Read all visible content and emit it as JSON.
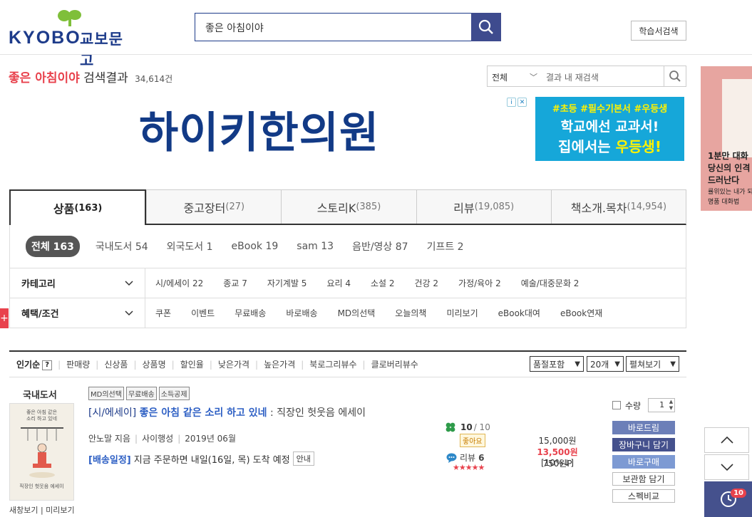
{
  "header": {
    "logo_en": "KYOBO",
    "logo_ko": "교보문고",
    "search_value": "좋은 아침이야",
    "study_button": "학습서검색"
  },
  "query": {
    "keyword": "좋은 아침이야",
    "label": "검색결과",
    "count": "34,614건"
  },
  "in_search": {
    "scope": "전체",
    "placeholder": "결과 내 재검색"
  },
  "ads": {
    "main_text": "하이키한의원",
    "box_line1": "#초등 #필수기본서 #우등생",
    "box_line2": "학교에선 교과서!",
    "box_line3a": "집에서는 ",
    "box_line3b": "우등생!",
    "side_title1": "1분만 대화",
    "side_title2": "당신의 인격",
    "side_title3": "드러난다",
    "side_sub1": "률위있는 내가 되",
    "side_sub2": "명품 대화법"
  },
  "tabs": [
    {
      "label": "상품",
      "count": "(163)"
    },
    {
      "label": "중고장터",
      "count": "(27)"
    },
    {
      "label": "스토리K",
      "count": "(385)"
    },
    {
      "label": "리뷰",
      "count": "(19,085)"
    },
    {
      "label": "책소개.목차",
      "count": "(14,954)"
    }
  ],
  "subtabs": [
    "전체 163",
    "국내도서 54",
    "외국도서 1",
    "eBook 19",
    "sam 13",
    "음반/영상 87",
    "기프트 2"
  ],
  "category": {
    "label": "카테고리",
    "items": [
      "시/에세이 22",
      "종교 7",
      "자기계발 5",
      "요리 4",
      "소설 2",
      "건강 2",
      "가정/육아 2",
      "예술/대중문화 2"
    ]
  },
  "benefits": {
    "label": "혜택/조건",
    "items": [
      "쿠폰",
      "이벤트",
      "무료배송",
      "바로배송",
      "MD의선택",
      "오늘의책",
      "미리보기",
      "eBook대여",
      "eBook연재"
    ]
  },
  "sort": {
    "items": [
      "인기순",
      "판매량",
      "신상품",
      "상품명",
      "할인율",
      "낮은가격",
      "높은가격",
      "북로그리뷰수",
      "클로버리뷰수"
    ],
    "help": "?",
    "select1": "품절포함",
    "select2": "20개",
    "select3": "펼쳐보기"
  },
  "product": {
    "category": "국내도서",
    "cover_title1": "좋은 아침 같은",
    "cover_title2": "소리 하고 있네",
    "cover_sub": "직장인 헛웃음 에세이",
    "cover_links": "새창보기 | 미리보기",
    "badges": [
      "MD의선택",
      "무료배송",
      "소득공제"
    ],
    "title_category": "[시/에세이]",
    "title": "좋은 아침 같은 소리 하고 있네",
    "subtitle": ": 직장인 헛웃음 에세이",
    "author": "안노말 지음",
    "publisher": "사이행성",
    "date": "2019년 06월",
    "ship_label": "[배송일정]",
    "ship_text": "지금 주문하면 내일(16일, 목) 도착 예정",
    "ship_info": "안내",
    "rating": "10",
    "rating_total": "/ 10",
    "like": "좋아요",
    "review_label": "리뷰",
    "review_count": "6",
    "stars": "★★★★★",
    "list_price": "15,000원",
    "sale_price": "13,500원",
    "discount": "[10%↓]",
    "points": "750원P",
    "qty_label": "수량",
    "qty_value": "1",
    "buttons": [
      "바로드림",
      "장바구니 담기",
      "바로구매",
      "보관함 담기",
      "스펙비교"
    ]
  },
  "recent_count": "10"
}
